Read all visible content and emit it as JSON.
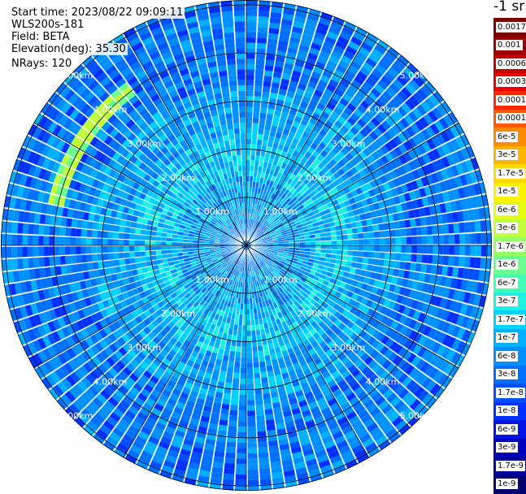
{
  "header": {
    "start_time": "Start time: 2023/08/22 09:09:11",
    "instrument": "WLS200s-181",
    "field": "Field: BETA",
    "elevation": "Elevation(deg): 35.30",
    "nrays": "NRays: 120"
  },
  "colorbar": {
    "title": "-1 sr",
    "entries": [
      {
        "label": "0.0017",
        "color": "#7a0000"
      },
      {
        "label": "0.001",
        "color": "#9a0000"
      },
      {
        "label": "0.0006",
        "color": "#c40000"
      },
      {
        "label": "0.0003",
        "color": "#ee0000"
      },
      {
        "label": "0.00017",
        "color": "#ff2a00"
      },
      {
        "label": "0.0001",
        "color": "#ff5a00"
      },
      {
        "label": "6e-5",
        "color": "#ff8a00"
      },
      {
        "label": "3e-5",
        "color": "#ffb400"
      },
      {
        "label": "1.7e-5",
        "color": "#ffd800"
      },
      {
        "label": "1e-5",
        "color": "#fff200"
      },
      {
        "label": "6e-6",
        "color": "#e6ff10"
      },
      {
        "label": "3e-6",
        "color": "#c0ff3a"
      },
      {
        "label": "1.7e-6",
        "color": "#96ff64"
      },
      {
        "label": "1e-6",
        "color": "#6cff8e"
      },
      {
        "label": "6e-7",
        "color": "#42ffb8"
      },
      {
        "label": "3e-7",
        "color": "#1cf2e2"
      },
      {
        "label": "1.7e-7",
        "color": "#00d2ff"
      },
      {
        "label": "1e-7",
        "color": "#00b0ff"
      },
      {
        "label": "6e-8",
        "color": "#0090ff"
      },
      {
        "label": "3e-8",
        "color": "#0070ff"
      },
      {
        "label": "1.7e-8",
        "color": "#0050ff"
      },
      {
        "label": "1e-8",
        "color": "#0030ff"
      },
      {
        "label": "6e-9",
        "color": "#0014e8"
      },
      {
        "label": "3e-9",
        "color": "#0000c0"
      },
      {
        "label": "1.7e-9",
        "color": "#000098"
      },
      {
        "label": "1e-9",
        "color": "#000070"
      }
    ]
  },
  "chart_data": {
    "type": "heatmap",
    "projection": "polar (PPI scan)",
    "field": "BETA",
    "elevation_deg": 35.3,
    "n_rays": 120,
    "range_rings_km": [
      1.0,
      2.0,
      3.0,
      4.0,
      5.0
    ],
    "ring_labels": [
      "1.00km",
      "2.00km",
      "3.00km",
      "4.00km",
      "5.00km"
    ],
    "max_range_km": 5.1,
    "spoke_angles_deg": [
      0,
      30,
      60,
      90,
      120,
      150,
      180,
      210,
      240,
      270,
      300,
      330
    ],
    "colorscale": "log",
    "value_range": [
      1e-09,
      0.0017
    ],
    "features": [
      {
        "description": "enhanced backscatter arc",
        "azimuth_range_deg": [
          282,
          325
        ],
        "range_km": [
          3.9,
          4.2
        ],
        "value": 1.7e-06
      }
    ]
  }
}
